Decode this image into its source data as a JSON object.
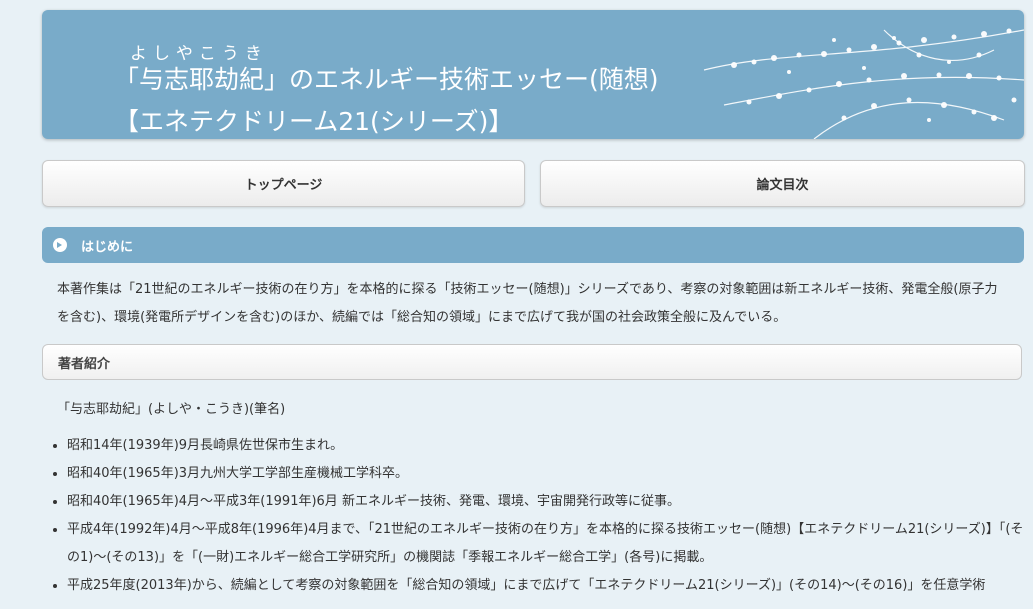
{
  "header": {
    "ruby": "よしやこうき",
    "title_line1": "「与志耶劫紀」のエネルギー技術エッセー(随想)",
    "title_line2": "【エネテクドリーム21(シリーズ)】"
  },
  "nav": {
    "top_page": "トップページ",
    "toc": "論文目次"
  },
  "intro": {
    "heading": "はじめに",
    "text": "本著作集は「21世紀のエネルギー技術の在り方」を本格的に探る「技術エッセー(随想)」シリーズであり、考察の対象範囲は新エネルギー技術、発電全般(原子力を含む)、環境(発電所デザインを含む)のほか、続編では「総合知の領域」にまで広げて我が国の社会政策全般に及んでいる。"
  },
  "profile": {
    "heading": "著者紹介",
    "author": "「与志耶劫紀」(よしや・こうき)(筆名)",
    "items": [
      "昭和14年(1939年)9月長崎県佐世保市生まれ。",
      "昭和40年(1965年)3月九州大学工学部生産機械工学科卒。",
      "昭和40年(1965年)4月～平成3年(1991年)6月 新エネルギー技術、発電、環境、宇宙開発行政等に従事。",
      "平成4年(1992年)4月～平成8年(1996年)4月まで、「21世紀のエネルギー技術の在り方」を本格的に探る技術エッセー(随想)【エネテクドリーム21(シリーズ)】「(その1)～(その13)」を「(一財)エネルギー総合工学研究所」の機関誌「季報エネルギー総合工学」(各号)に掲載。",
      "平成25年度(2013年)から、続編として考察の対象範囲を「総合知の領域」にまで広げて「エネテクドリーム21(シリーズ)」(その14)～(その16)」を任意学術"
    ]
  },
  "colors": {
    "accent": "#79abc9",
    "background": "#e8f1f6"
  }
}
